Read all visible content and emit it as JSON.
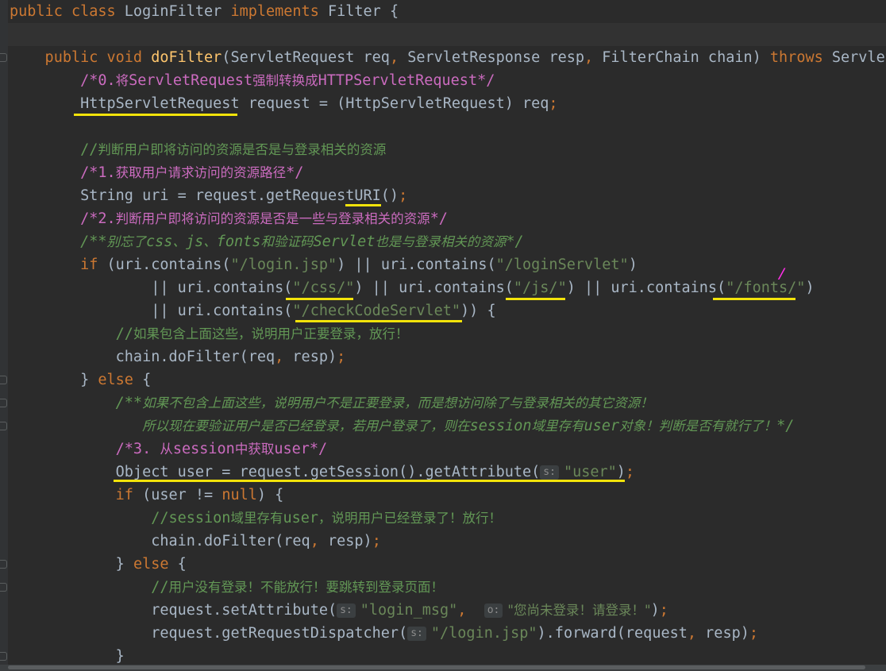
{
  "editor": {
    "colors": {
      "background": "#2b2b2b",
      "keyword": "#cc7832",
      "method": "#ffc66d",
      "string": "#6a8759",
      "comment": "#629755",
      "block_comment": "#cb6bbf",
      "highlight_underline": "#f2e30a",
      "pen_mark": "#ff2fe7"
    },
    "lines": [
      {
        "segments": [
          {
            "t": "public class ",
            "c": "kw"
          },
          {
            "t": "LoginFilter "
          },
          {
            "t": "implements ",
            "c": "kw"
          },
          {
            "t": "Filter {"
          }
        ]
      },
      {
        "segments": []
      },
      {
        "segments": [
          {
            "t": "    public void ",
            "c": "kw"
          },
          {
            "t": "doFilter",
            "c": "fn"
          },
          {
            "t": "(ServletRequest req"
          },
          {
            "t": ", ",
            "c": "kw"
          },
          {
            "t": "ServletResponse resp"
          },
          {
            "t": ", ",
            "c": "kw"
          },
          {
            "t": "FilterChain chain) "
          },
          {
            "t": "throws ",
            "c": "kw"
          },
          {
            "t": "ServletE"
          }
        ]
      },
      {
        "segments": [
          {
            "t": "        /*0.",
            "c": "blk"
          },
          {
            "t": "将",
            "c": "blk cn"
          },
          {
            "t": "ServletRequest",
            "c": "blk"
          },
          {
            "t": "强制转换成",
            "c": "blk cn"
          },
          {
            "t": "HTTPServletRequest*/",
            "c": "blk"
          }
        ]
      },
      {
        "segments": [
          {
            "t": "        HttpServletRequest request = (HttpServletRequest) req"
          },
          {
            "t": ";",
            "c": "kw"
          }
        ]
      },
      {
        "segments": []
      },
      {
        "segments": [
          {
            "t": "        //",
            "c": "cmt"
          },
          {
            "t": "判断用户即将访问的资源是否是与登录相关的资源",
            "c": "cmt cn"
          }
        ]
      },
      {
        "segments": [
          {
            "t": "        /*1.",
            "c": "blk"
          },
          {
            "t": "获取用户请求访问的资源路径",
            "c": "blk cn"
          },
          {
            "t": "*/",
            "c": "blk"
          }
        ]
      },
      {
        "segments": [
          {
            "t": "        String uri = request.getRequestURI()"
          },
          {
            "t": ";",
            "c": "kw"
          }
        ]
      },
      {
        "segments": [
          {
            "t": "        /*2.",
            "c": "blk"
          },
          {
            "t": "判断用户即将访问的资源是否是一些与登录相关的资源",
            "c": "blk cn"
          },
          {
            "t": "*/",
            "c": "blk"
          }
        ]
      },
      {
        "segments": [
          {
            "t": "        /**",
            "c": "dcmt"
          },
          {
            "t": "别忘了",
            "c": "dcmt cn"
          },
          {
            "t": "css",
            "c": "dcmt"
          },
          {
            "t": "、",
            "c": "dcmt cn"
          },
          {
            "t": "js",
            "c": "dcmt"
          },
          {
            "t": "、",
            "c": "dcmt cn"
          },
          {
            "t": "fonts",
            "c": "dcmt"
          },
          {
            "t": "和验证码",
            "c": "dcmt cn"
          },
          {
            "t": "Servlet",
            "c": "dcmt"
          },
          {
            "t": "也是与登录相关的资源",
            "c": "dcmt cn"
          },
          {
            "t": "*/",
            "c": "dcmt"
          }
        ]
      },
      {
        "segments": [
          {
            "t": "        if ",
            "c": "kw"
          },
          {
            "t": "(uri.contains("
          },
          {
            "t": "\"/login.jsp\"",
            "c": "str"
          },
          {
            "t": ") || uri.contains("
          },
          {
            "t": "\"/loginServlet\"",
            "c": "str"
          },
          {
            "t": ")"
          }
        ]
      },
      {
        "segments": [
          {
            "t": "                || uri.contains("
          },
          {
            "t": "\"/css/\"",
            "c": "str"
          },
          {
            "t": ") || uri.contains("
          },
          {
            "t": "\"/js/\"",
            "c": "str"
          },
          {
            "t": ") || uri.contains("
          },
          {
            "t": "\"/fonts/\"",
            "c": "str"
          },
          {
            "t": ")"
          }
        ]
      },
      {
        "segments": [
          {
            "t": "                || uri.contains("
          },
          {
            "t": "\"/checkCodeServlet\"",
            "c": "str"
          },
          {
            "t": ")) {"
          }
        ]
      },
      {
        "segments": [
          {
            "t": "            //",
            "c": "cmt"
          },
          {
            "t": "如果包含上面这些，说明用户正要登录，放行！",
            "c": "cmt cn"
          }
        ]
      },
      {
        "segments": [
          {
            "t": "            chain.doFilter(req"
          },
          {
            "t": ", ",
            "c": "kw"
          },
          {
            "t": "resp)"
          },
          {
            "t": ";",
            "c": "kw"
          }
        ]
      },
      {
        "segments": [
          {
            "t": "        } "
          },
          {
            "t": "else ",
            "c": "kw"
          },
          {
            "t": "{"
          }
        ]
      },
      {
        "segments": [
          {
            "t": "            /**",
            "c": "dcmt"
          },
          {
            "t": "如果不包含上面这些，说明用户不是正要登录，而是想访问除了与登录相关的其它资源！",
            "c": "dcmt cn"
          }
        ]
      },
      {
        "segments": [
          {
            "t": "               ",
            "c": "dcmt"
          },
          {
            "t": "所以现在要验证用户是否已经登录，若用户登录了，则在",
            "c": "dcmt cn"
          },
          {
            "t": "session",
            "c": "dcmt"
          },
          {
            "t": "域里存有",
            "c": "dcmt cn"
          },
          {
            "t": "user",
            "c": "dcmt"
          },
          {
            "t": "对象！判断是否有就行了！",
            "c": "dcmt cn"
          },
          {
            "t": "*/",
            "c": "dcmt"
          }
        ]
      },
      {
        "segments": [
          {
            "t": "            /*3. ",
            "c": "blk"
          },
          {
            "t": "从",
            "c": "blk cn"
          },
          {
            "t": "session",
            "c": "blk"
          },
          {
            "t": "中获取",
            "c": "blk cn"
          },
          {
            "t": "user*/",
            "c": "blk"
          }
        ]
      },
      {
        "segments": [
          {
            "t": "            Object user = request.getSession().getAttribute("
          },
          {
            "hint": "s:"
          },
          {
            "t": "\"user\"",
            "c": "str"
          },
          {
            "t": ")"
          },
          {
            "t": ";",
            "c": "kw"
          }
        ]
      },
      {
        "segments": [
          {
            "t": "            if ",
            "c": "kw"
          },
          {
            "t": "(user != "
          },
          {
            "t": "null",
            "c": "kw"
          },
          {
            "t": ") {"
          }
        ]
      },
      {
        "segments": [
          {
            "t": "                //",
            "c": "cmt"
          },
          {
            "t": "session",
            "c": "cmt"
          },
          {
            "t": "域里存有",
            "c": "cmt cn"
          },
          {
            "t": "user",
            "c": "cmt"
          },
          {
            "t": "，说明用户已经登录了！放行！",
            "c": "cmt cn"
          }
        ]
      },
      {
        "segments": [
          {
            "t": "                chain.doFilter(req"
          },
          {
            "t": ", ",
            "c": "kw"
          },
          {
            "t": "resp)"
          },
          {
            "t": ";",
            "c": "kw"
          }
        ]
      },
      {
        "segments": [
          {
            "t": "            } "
          },
          {
            "t": "else ",
            "c": "kw"
          },
          {
            "t": "{"
          }
        ]
      },
      {
        "segments": [
          {
            "t": "                //",
            "c": "cmt"
          },
          {
            "t": "用户没有登录！不能放行！要跳转到登录页面！",
            "c": "cmt cn"
          }
        ]
      },
      {
        "segments": [
          {
            "t": "                request.setAttribute("
          },
          {
            "hint": "s:"
          },
          {
            "t": "\"login_msg\"",
            "c": "str"
          },
          {
            "t": ",  ",
            "c": "kw"
          },
          {
            "hint": "o:"
          },
          {
            "t": "\"您尚未登录！请登录！\"",
            "c": "str cn"
          },
          {
            "t": ")"
          },
          {
            "t": ";",
            "c": "kw"
          }
        ]
      },
      {
        "segments": [
          {
            "t": "                request.getRequestDispatcher("
          },
          {
            "hint": "s:"
          },
          {
            "t": "\"/login.jsp\"",
            "c": "str"
          },
          {
            "t": ").forward(request"
          },
          {
            "t": ", ",
            "c": "kw"
          },
          {
            "t": "resp)"
          },
          {
            "t": ";",
            "c": "kw"
          }
        ]
      },
      {
        "segments": [
          {
            "t": "            }"
          }
        ]
      }
    ]
  }
}
